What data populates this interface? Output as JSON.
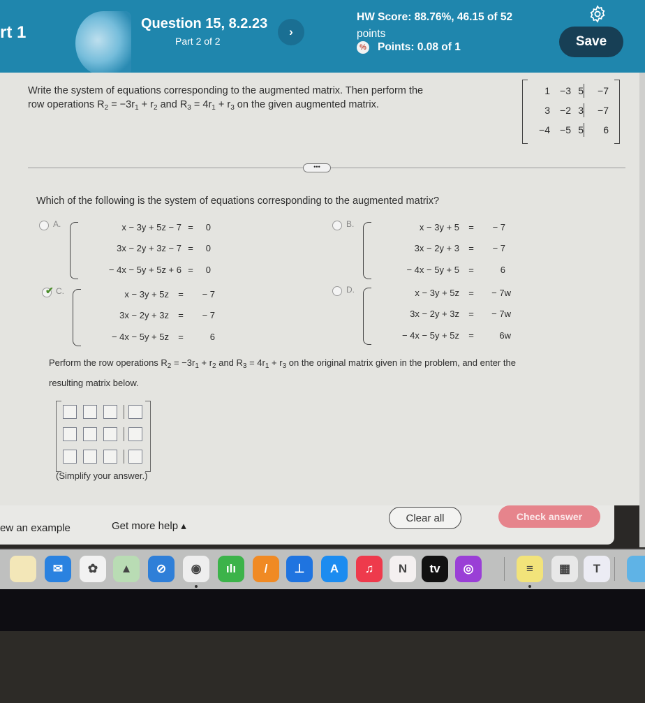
{
  "header": {
    "part_label": "rt 1",
    "question_title": "Question 15, 8.2.23",
    "question_part": "Part 2 of 2",
    "next_icon": "chevron-right-icon",
    "hw_score": "HW Score: 88.76%, 46.15 of 52",
    "hw_score_suffix": "points",
    "points": "Points: 0.08 of 1",
    "partial_credit_icon": "partial-credit-icon",
    "settings_icon": "gear-icon",
    "save_label": "Save",
    "colors": {
      "header_bg": "#1f86ad",
      "save_bg": "#173f55"
    }
  },
  "problem": {
    "instruction_line1": "Write the system of equations corresponding to the augmented matrix. Then perform the",
    "instruction_prefix": "row operations ",
    "op1": {
      "lhs": "R",
      "lhs_sub": "2",
      "rhs": " = −3r",
      "r1_sub": "1",
      "plus": " + r",
      "r2_sub": "2"
    },
    "and": " and ",
    "op2": {
      "lhs": "R",
      "lhs_sub": "3",
      "rhs": " = 4r",
      "r1_sub": "1",
      "plus": " + r",
      "r2_sub": "3"
    },
    "instruction_suffix": " on the given augmented matrix.",
    "matrix": {
      "rows": [
        {
          "coeffs": [
            "1",
            "−3",
            "5"
          ],
          "aug": "−7"
        },
        {
          "coeffs": [
            "3",
            "−2",
            "3"
          ],
          "aug": "−7"
        },
        {
          "coeffs": [
            "−4",
            "−5",
            "5"
          ],
          "aug": "6"
        }
      ]
    }
  },
  "divider_more_label": "•••",
  "question": "Which of the following is the system of equations corresponding to the augmented matrix?",
  "options": [
    {
      "letter": "A.",
      "selected": false,
      "equations": [
        {
          "lhs": "x − 3y + 5z − 7",
          "eq": "=",
          "rhs": "0"
        },
        {
          "lhs": "3x − 2y + 3z − 7",
          "eq": "=",
          "rhs": "0"
        },
        {
          "lhs": "− 4x − 5y + 5z + 6",
          "eq": "=",
          "rhs": "0"
        }
      ]
    },
    {
      "letter": "B.",
      "selected": false,
      "equations": [
        {
          "lhs": "x − 3y + 5",
          "eq": "=",
          "rhs": "− 7"
        },
        {
          "lhs": "3x − 2y + 3",
          "eq": "=",
          "rhs": "− 7"
        },
        {
          "lhs": "− 4x − 5y + 5",
          "eq": "=",
          "rhs": "6"
        }
      ]
    },
    {
      "letter": "C.",
      "selected": true,
      "correct_mark": "✔",
      "equations": [
        {
          "lhs": "x − 3y + 5z",
          "eq": "=",
          "rhs": "− 7"
        },
        {
          "lhs": "3x − 2y + 3z",
          "eq": "=",
          "rhs": "− 7"
        },
        {
          "lhs": "− 4x − 5y + 5z",
          "eq": "=",
          "rhs": "6"
        }
      ]
    },
    {
      "letter": "D.",
      "selected": false,
      "equations": [
        {
          "lhs": "x − 3y + 5z",
          "eq": "=",
          "rhs": "− 7w"
        },
        {
          "lhs": "3x − 2y + 3z",
          "eq": "=",
          "rhs": "− 7w"
        },
        {
          "lhs": "− 4x − 5y + 5z",
          "eq": "=",
          "rhs": "6w"
        }
      ]
    }
  ],
  "perform": {
    "prefix": "Perform the row operations ",
    "op1": {
      "lhs": "R",
      "lhs_sub": "2",
      "rhs": " = −3r",
      "r1_sub": "1",
      "plus": " + r",
      "r2_sub": "2"
    },
    "and": " and ",
    "op2": {
      "lhs": "R",
      "lhs_sub": "3",
      "rhs": " = 4r",
      "r1_sub": "1",
      "plus": " + r",
      "r2_sub": "3"
    },
    "suffix": " on the original matrix given in the problem, and enter the",
    "line2": "resulting matrix below."
  },
  "answer_matrix": {
    "rows": [
      {
        "coeffs": [
          "",
          "",
          ""
        ],
        "aug": ""
      },
      {
        "coeffs": [
          "",
          "",
          ""
        ],
        "aug": ""
      },
      {
        "coeffs": [
          "",
          "",
          ""
        ],
        "aug": ""
      }
    ],
    "hint": "(Simplify your answer.)"
  },
  "footer": {
    "example_label": "ew an example",
    "help_label": "Get more help ▴",
    "clear_label": "Clear all",
    "check_label": "Check answer",
    "check_color": "#e6848c"
  },
  "dock": {
    "apps": [
      {
        "name": "notes",
        "icon": "notes-icon",
        "glyph": "",
        "color": "#f3e7b8"
      },
      {
        "name": "mail",
        "icon": "mail-icon",
        "glyph": "✉",
        "color": "#2a82e0"
      },
      {
        "name": "photos",
        "icon": "photos-icon",
        "glyph": "✿",
        "color": "#f2f2f2"
      },
      {
        "name": "maps",
        "icon": "maps-icon",
        "glyph": "▲",
        "color": "#b9dcb4"
      },
      {
        "name": "safari",
        "icon": "safari-icon",
        "glyph": "⊘",
        "color": "#2f7fd8"
      },
      {
        "name": "chrome",
        "icon": "chrome-icon",
        "glyph": "◉",
        "color": "#eeeeee"
      },
      {
        "name": "numbers",
        "icon": "numbers-icon",
        "glyph": "ılı",
        "color": "#3cb34a"
      },
      {
        "name": "pages",
        "icon": "pages-icon",
        "glyph": "/",
        "color": "#f08a24"
      },
      {
        "name": "keynote",
        "icon": "keynote-icon",
        "glyph": "⊥",
        "color": "#1f74e0"
      },
      {
        "name": "app-store",
        "icon": "app-store-icon",
        "glyph": "A",
        "color": "#1c8cf0"
      },
      {
        "name": "music",
        "icon": "music-icon",
        "glyph": "♫",
        "color": "#ee3a4c"
      },
      {
        "name": "news",
        "icon": "news-icon",
        "glyph": "N",
        "color": "#f4f0f0"
      },
      {
        "name": "apple-tv",
        "icon": "apple-tv-icon",
        "glyph": "tv",
        "color": "#111111"
      },
      {
        "name": "podcasts",
        "icon": "podcasts-icon",
        "glyph": "◎",
        "color": "#9a3fd6"
      },
      {
        "name": "stickies",
        "icon": "stickies-icon",
        "glyph": "≡",
        "color": "#f2e37a"
      },
      {
        "name": "calculator",
        "icon": "calculator-icon",
        "glyph": "▦",
        "color": "#e8e8e8"
      },
      {
        "name": "teams",
        "icon": "teams-icon",
        "glyph": "T",
        "color": "#ececf4"
      },
      {
        "name": "downloads-folder",
        "icon": "folder-icon",
        "glyph": "",
        "color": "#5fb3e6"
      }
    ]
  }
}
